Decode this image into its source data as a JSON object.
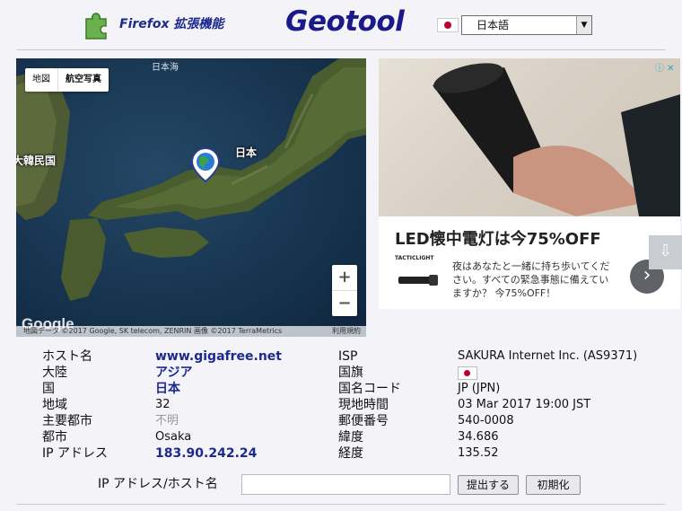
{
  "header": {
    "extension_label": "Firefox 拡張機能",
    "logo": "Geotool",
    "language": "日本語"
  },
  "map": {
    "tabs": [
      "地図",
      "航空写真"
    ],
    "labels": {
      "sea": "日本海",
      "korea": "大韓民国",
      "japan": "日本"
    },
    "zoom_in": "+",
    "zoom_out": "−",
    "google": "Google",
    "attribution": "地図データ ©2017 Google, SK telecom, ZENRIN 画像 ©2017 TerraMetrics",
    "terms": "利用規約"
  },
  "ad": {
    "title": "LED懐中電灯は今75%OFF",
    "brand": "TACTICLIGHT",
    "text": "夜はあなたと一緒に持ち歩いてください。すべての緊急事態に備えていますか？ 今75%OFF！",
    "next": "›",
    "info": "ⓘ ✕"
  },
  "info_left": [
    {
      "label": "ホスト名",
      "value": "www.gigafree.net",
      "style": "link"
    },
    {
      "label": "大陸",
      "value": "アジア",
      "style": "link"
    },
    {
      "label": "国",
      "value": "日本",
      "style": "link"
    },
    {
      "label": "地域",
      "value": "32",
      "style": "plain"
    },
    {
      "label": "主要都市",
      "value": "不明",
      "style": "gray"
    },
    {
      "label": "都市",
      "value": "Osaka",
      "style": "plain"
    },
    {
      "label": "IP アドレス",
      "value": "183.90.242.24",
      "style": "link"
    }
  ],
  "info_right": [
    {
      "label": "ISP",
      "value": "SAKURA Internet Inc. (AS9371)"
    },
    {
      "label": "国旗",
      "value": ""
    },
    {
      "label": "国名コード",
      "value": "JP (JPN)"
    },
    {
      "label": "現地時間",
      "value": "03 Mar 2017 19:00 JST"
    },
    {
      "label": "郵便番号",
      "value": "540-0008"
    },
    {
      "label": "緯度",
      "value": "34.686"
    },
    {
      "label": "経度",
      "value": "135.52"
    }
  ],
  "query": {
    "label": "IP アドレス/ホスト名",
    "value": "",
    "submit": "提出する",
    "reset": "初期化"
  },
  "colors": {
    "accent": "#1b2a8c",
    "flag_red": "#bc002d"
  }
}
